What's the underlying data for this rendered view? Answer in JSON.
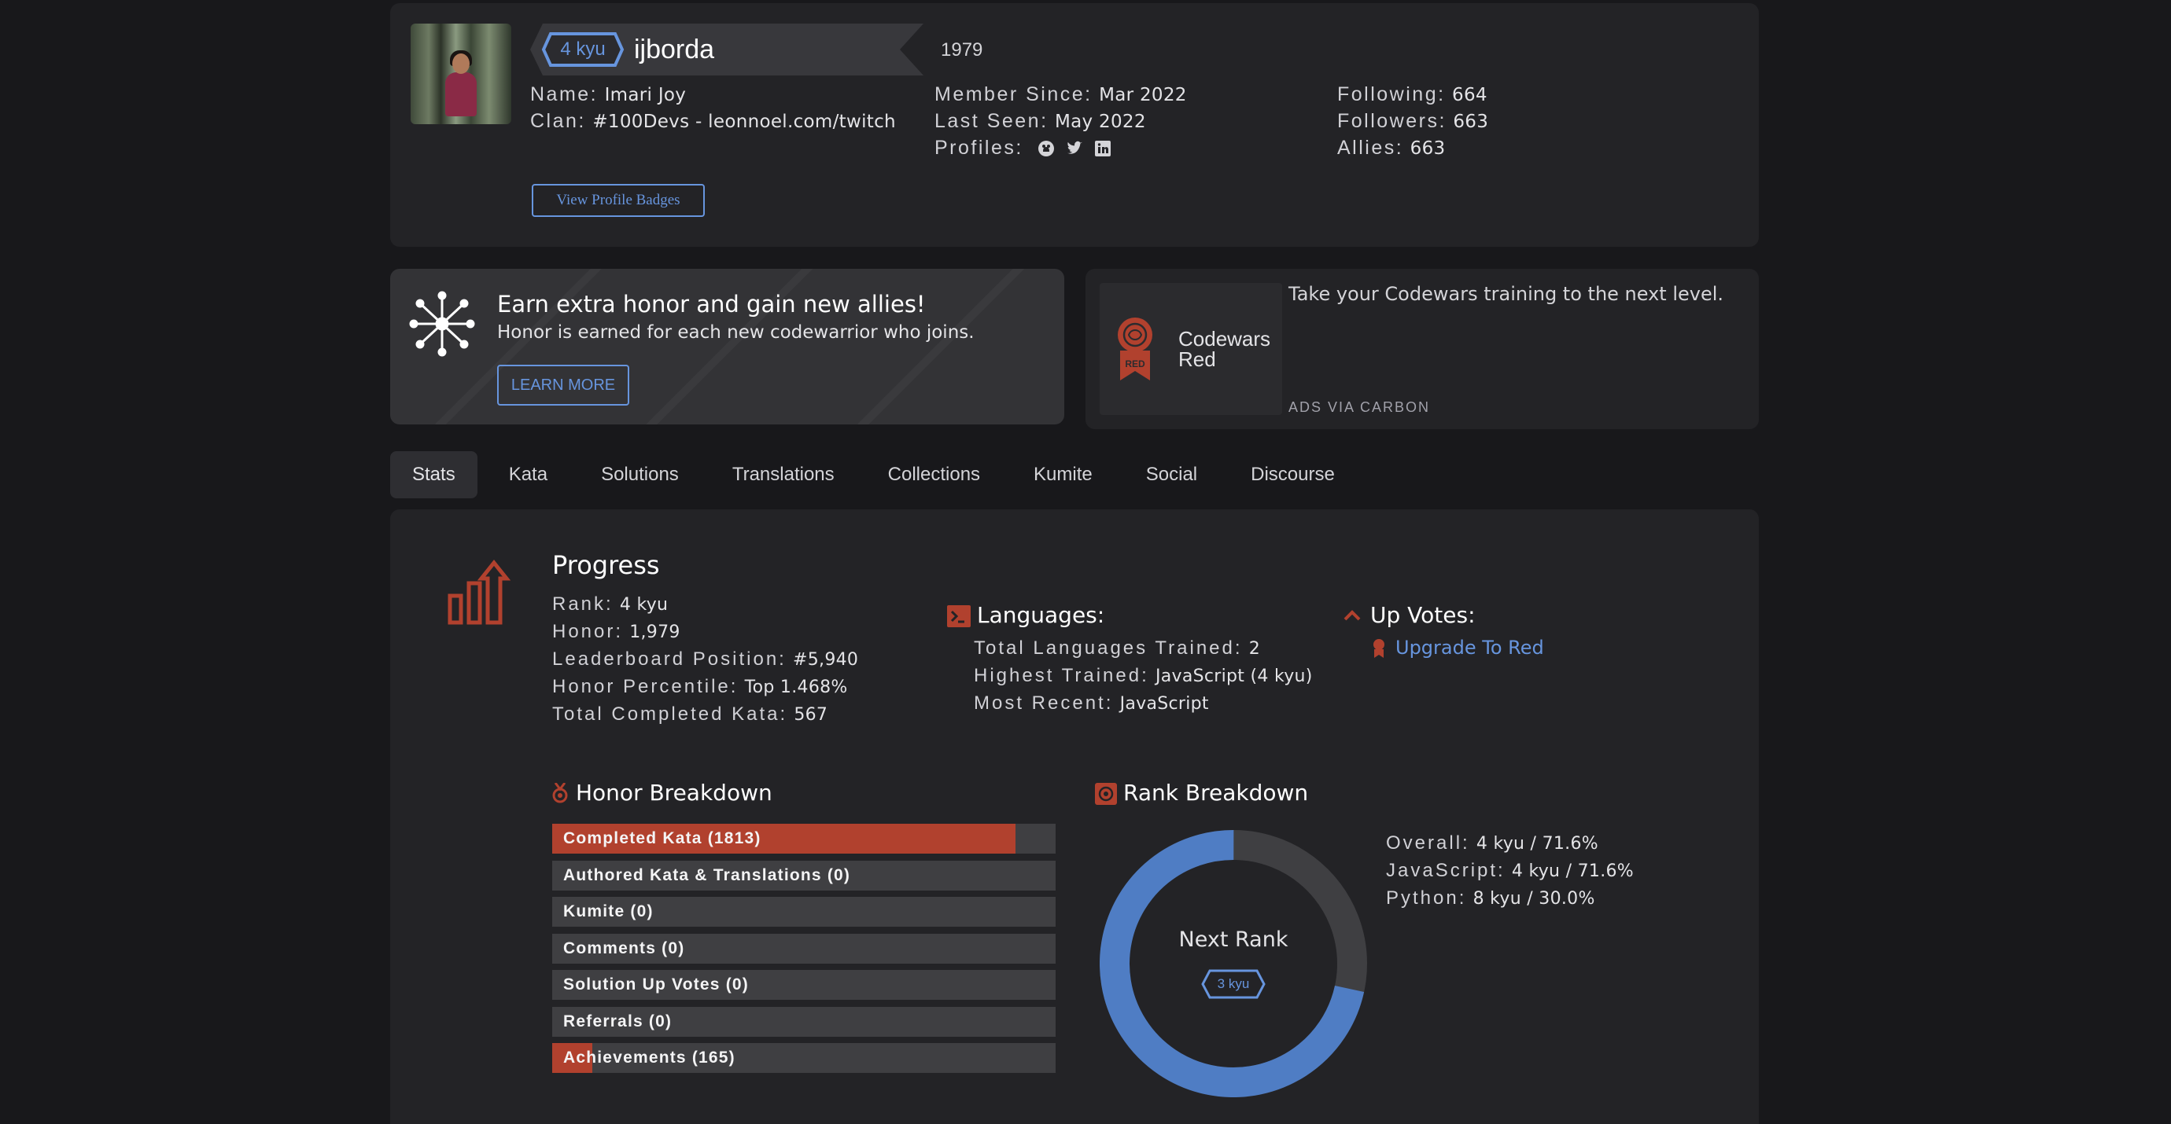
{
  "profile": {
    "rank": "4 kyu",
    "username": "ijborda",
    "honor": "1979",
    "name_label": "Name:",
    "name": "Imari Joy",
    "clan_label": "Clan:",
    "clan": "#100Devs - leonnoel.com/twitch",
    "member_since_label": "Member Since:",
    "member_since": "Mar 2022",
    "last_seen_label": "Last Seen:",
    "last_seen": "May 2022",
    "profiles_label": "Profiles:",
    "profile_icons": [
      "github-icon",
      "twitter-icon",
      "linkedin-icon"
    ],
    "following_label": "Following:",
    "following": "664",
    "followers_label": "Followers:",
    "followers": "663",
    "allies_label": "Allies:",
    "allies": "663",
    "view_badges": "View Profile Badges"
  },
  "referral": {
    "title": "Earn extra honor and gain new allies!",
    "subtitle": "Honor is earned for each new codewarrior who joins.",
    "button": "LEARN MORE"
  },
  "ad": {
    "title_line1": "Codewars",
    "title_line2": "Red",
    "badge_text": "RED",
    "text": "Take your Codewars training to the next level.",
    "via": "ADS VIA CARBON"
  },
  "tabs": [
    "Stats",
    "Kata",
    "Solutions",
    "Translations",
    "Collections",
    "Kumite",
    "Social",
    "Discourse"
  ],
  "active_tab": "Stats",
  "progress": {
    "title": "Progress",
    "rank_label": "Rank:",
    "rank": "4 kyu",
    "honor_label": "Honor:",
    "honor": "1,979",
    "leaderboard_label": "Leaderboard Position:",
    "leaderboard": "#5,940",
    "percentile_label": "Honor Percentile:",
    "percentile": "Top 1.468%",
    "completed_label": "Total Completed Kata:",
    "completed": "567"
  },
  "languages": {
    "title": "Languages:",
    "total_label": "Total Languages Trained:",
    "total": "2",
    "highest_label": "Highest Trained:",
    "highest": "JavaScript (4 kyu)",
    "recent_label": "Most Recent:",
    "recent": "JavaScript"
  },
  "upvotes": {
    "title": "Up Votes:",
    "link": "Upgrade To Red"
  },
  "honor_breakdown": {
    "title": "Honor Breakdown",
    "rows": [
      {
        "label": "Completed Kata (1813)",
        "fraction": 0.92
      },
      {
        "label": "Authored Kata & Translations (0)",
        "fraction": 0
      },
      {
        "label": "Kumite (0)",
        "fraction": 0
      },
      {
        "label": "Comments (0)",
        "fraction": 0
      },
      {
        "label": "Solution Up Votes (0)",
        "fraction": 0
      },
      {
        "label": "Referrals (0)",
        "fraction": 0
      },
      {
        "label": "Achievements (165)",
        "fraction": 0.08
      }
    ]
  },
  "rank_breakdown": {
    "title": "Rank Breakdown",
    "next_rank_label": "Next Rank",
    "next_rank": "3 kyu",
    "progress": 0.716,
    "overall_label": "Overall:",
    "overall": "4 kyu / 71.6%",
    "javascript_label": "JavaScript:",
    "javascript": "4 kyu / 71.6%",
    "python_label": "Python:",
    "python": "8 kyu / 30.0%"
  },
  "colors": {
    "accent_blue": "#6795de",
    "accent_red": "#b1412e",
    "background": "#18181b",
    "card": "#232326"
  }
}
